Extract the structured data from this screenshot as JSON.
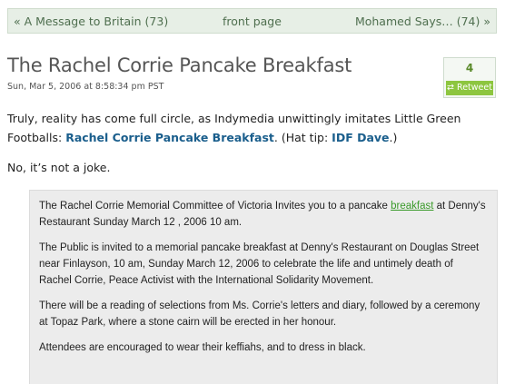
{
  "nav": {
    "prev": "« A Message to Britain (73)",
    "front": "front page",
    "next": "Mohamed Says… (74) »"
  },
  "post": {
    "title": "The Rachel Corrie Pancake Breakfast",
    "date": "Sun, Mar 5, 2006 at 8:58:34 pm PST",
    "retweet_count": "4",
    "retweet_label": "Retweet",
    "retweet_icon": "retweet-icon",
    "p1_before": "Truly, reality has come full circle, as Indymedia unwittingly imitates Little Green Footballs: ",
    "p1_link": "Rachel Corrie Pancake Breakfast",
    "p1_mid": ". (Hat tip: ",
    "p1_link2": "IDF Dave",
    "p1_after": ".)",
    "p2": "No, it’s not a joke."
  },
  "quote": {
    "q1_before": "The Rachel Corrie Memorial Committee of Victoria Invites you to a pancake ",
    "q1_link": "breakfast",
    "q1_after": " at Denny's Restaurant Sunday March 12 , 2006 10 am.",
    "q2": "The Public is invited to a memorial pancake breakfast at Denny's Restaurant on Douglas Street near Finlayson, 10 am, Sunday March 12, 2006 to celebrate the life and untimely death of Rachel Corrie, Peace Activist with the International Solidarity Movement.",
    "q3": "There will be a reading of selections from Ms. Corrie's letters and diary, followed by a ceremony at Topaz Park, where a stone cairn will be erected in her honour.",
    "q4": "Attendees are encouraged to wear their keffiahs, and to dress in black."
  },
  "colors": {
    "nav_bg": "#e7efe6",
    "link": "#1a5e8c",
    "retweet_green": "#8dc63f"
  }
}
